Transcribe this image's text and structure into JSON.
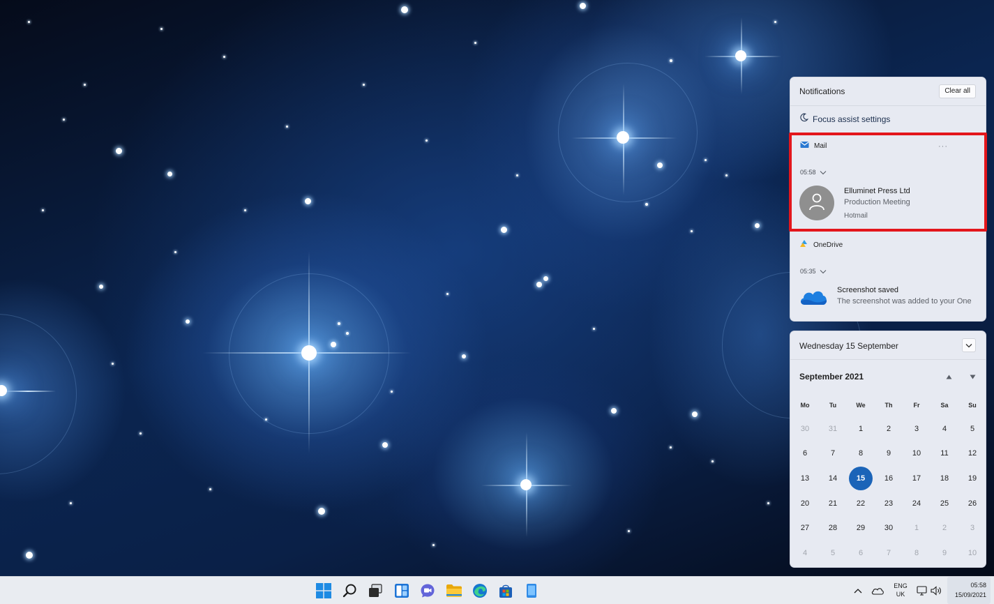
{
  "notifications": {
    "title": "Notifications",
    "clear_all": "Clear all",
    "focus_assist": "Focus assist settings",
    "mail": {
      "app": "Mail",
      "time": "05:58",
      "sender": "Elluminet Press Ltd",
      "subject": "Production Meeting",
      "account": "Hotmail"
    },
    "onedrive": {
      "app": "OneDrive",
      "time": "05:35",
      "title": "Screenshot saved",
      "body": "The screenshot was added to your One"
    }
  },
  "calendar": {
    "date_header": "Wednesday 15 September",
    "month_label": "September 2021",
    "weekdays": [
      "Mo",
      "Tu",
      "We",
      "Th",
      "Fr",
      "Sa",
      "Su"
    ],
    "weeks": [
      [
        "30",
        "31",
        "1",
        "2",
        "3",
        "4",
        "5"
      ],
      [
        "6",
        "7",
        "8",
        "9",
        "10",
        "11",
        "12"
      ],
      [
        "13",
        "14",
        "15",
        "16",
        "17",
        "18",
        "19"
      ],
      [
        "20",
        "21",
        "22",
        "23",
        "24",
        "25",
        "26"
      ],
      [
        "27",
        "28",
        "29",
        "30",
        "1",
        "2",
        "3"
      ],
      [
        "4",
        "5",
        "6",
        "7",
        "8",
        "9",
        "10"
      ]
    ],
    "today": "15",
    "accent_color": "#1b64b8"
  },
  "taskbar": {
    "apps": [
      "windows-start-icon",
      "search-icon",
      "task-view-icon",
      "widgets-icon",
      "teams-chat-icon",
      "file-explorer-icon",
      "edge-icon",
      "store-icon",
      "phone-app-icon"
    ],
    "language": "ENG",
    "region": "UK",
    "time": "05:58",
    "date": "15/09/2021"
  },
  "highlight_color": "#e3161c"
}
